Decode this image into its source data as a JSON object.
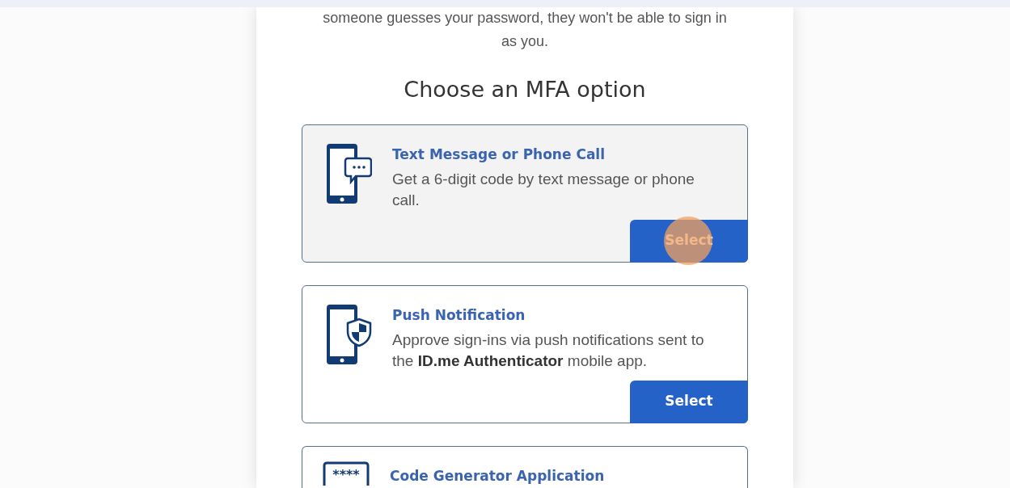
{
  "intro": "someone guesses your password, they won't be able to sign in as you.",
  "heading": "Choose an MFA option",
  "options": [
    {
      "kind": "phone-chat",
      "title": "Text Message or Phone Call",
      "description": "Get a 6-digit code by text message or phone call.",
      "button": "Select",
      "clicked": true
    },
    {
      "kind": "phone-shield",
      "title": "Push Notification",
      "description": "Approve sign-ins via push notifications sent to the **ID.me Authenticator** mobile app.",
      "button": "Select",
      "clicked": false
    },
    {
      "kind": "code-box",
      "icon_text": "****",
      "title": "Code Generator Application"
    }
  ]
}
